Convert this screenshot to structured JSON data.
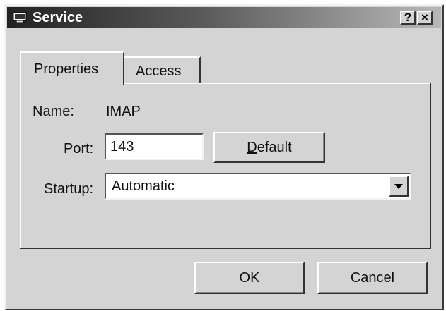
{
  "window": {
    "title": "Service",
    "help_button": "?",
    "close_button": "×"
  },
  "tabs": [
    {
      "label": "Properties",
      "active": true
    },
    {
      "label": "Access",
      "active": false
    }
  ],
  "properties": {
    "name_label": "Name:",
    "name_value": "IMAP",
    "port_label": "Port:",
    "port_value": "143",
    "default_button": "Default",
    "startup_label": "Startup:",
    "startup_value": "Automatic"
  },
  "footer": {
    "ok_button": "OK",
    "cancel_button": "Cancel"
  },
  "icons": {
    "title": "computer-icon",
    "dropdown": "chevron-down-icon"
  }
}
